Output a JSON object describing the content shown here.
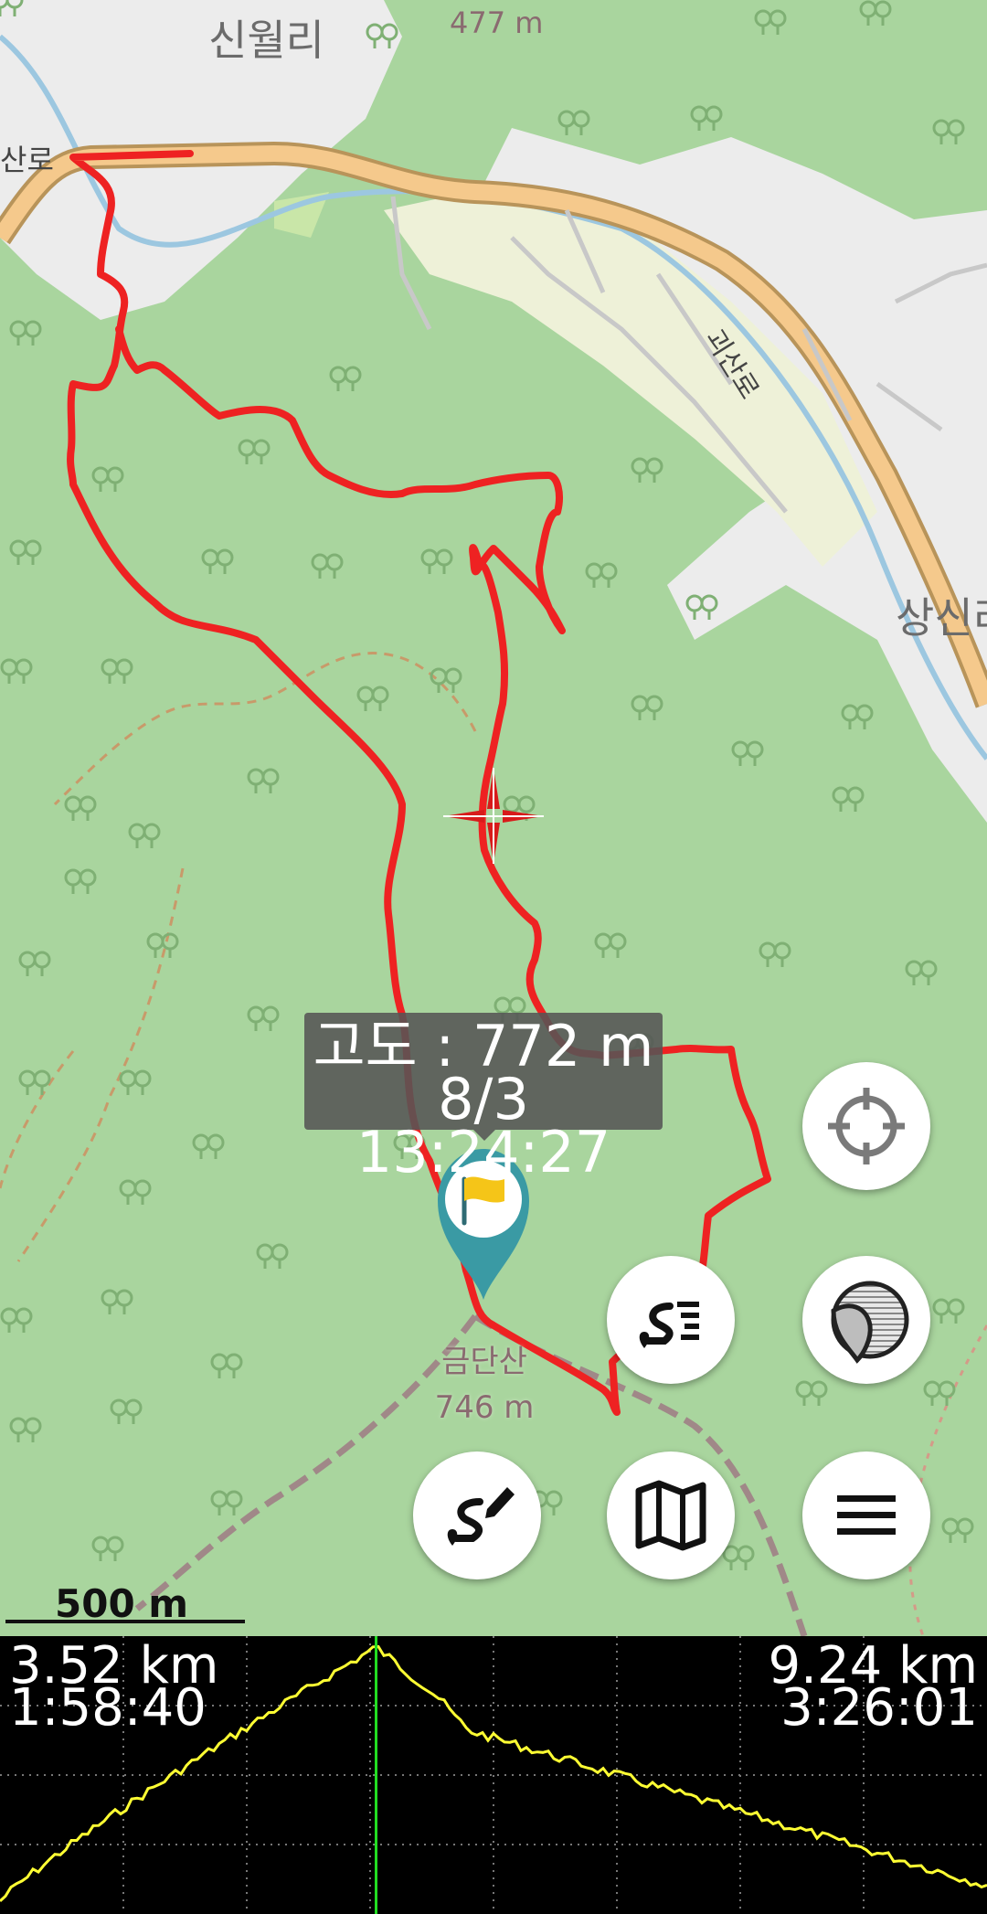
{
  "map": {
    "labels": {
      "village_top": "신월리",
      "elevation_top": "477 m",
      "road_left": "산로",
      "road_right": "괴산로",
      "village_right": "상신리"
    },
    "peak": {
      "name": "금단산",
      "elevation": "746 m"
    },
    "scale_label": "500 m"
  },
  "tooltip": {
    "altitude_line": "고도 : 772 m",
    "time_line": "8/3 13:24:27"
  },
  "buttons": {
    "locate": "crosshair-icon",
    "track_list": "track-list-icon",
    "map_layer": "layer-peel-icon",
    "track_edit": "route-edit-icon",
    "map": "folded-map-icon",
    "menu": "hamburger-menu-icon"
  },
  "profile": {
    "left_distance": "3.52 km",
    "left_time": "1:58:40",
    "right_distance": "9.24 km",
    "right_time": "3:26:01",
    "cursor_fraction": 0.381,
    "colors": {
      "line": "#ffff33",
      "cursor": "#22dd22",
      "track": "#ee2222"
    }
  }
}
